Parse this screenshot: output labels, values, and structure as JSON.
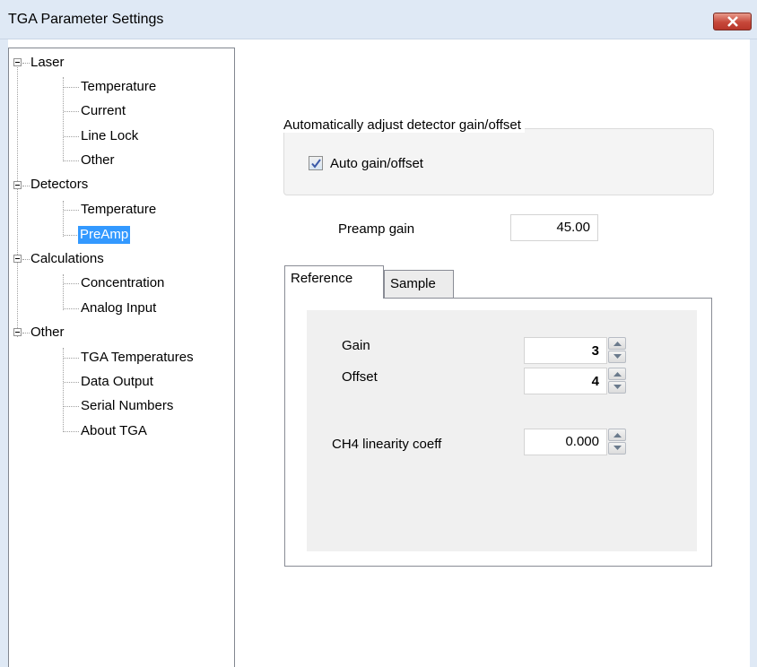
{
  "window": {
    "title": "TGA Parameter Settings"
  },
  "tree": [
    {
      "label": "Laser",
      "children": [
        "Temperature",
        "Current",
        "Line Lock",
        "Other"
      ]
    },
    {
      "label": "Detectors",
      "children": [
        "Temperature",
        "PreAmp"
      ]
    },
    {
      "label": "Calculations",
      "children": [
        "Concentration",
        "Analog Input"
      ]
    },
    {
      "label": "Other",
      "children": [
        "TGA Temperatures",
        "Data Output",
        "Serial Numbers",
        "About TGA"
      ]
    }
  ],
  "selected_item": "PreAmp",
  "auto_group": {
    "title": "Automatically adjust detector gain/offset",
    "checkbox_label": "Auto gain/offset",
    "checked": true
  },
  "preamp": {
    "label": "Preamp gain",
    "value": "45.00"
  },
  "tabs": [
    "Reference",
    "Sample"
  ],
  "active_tab": "Reference",
  "reference": {
    "gain_label": "Gain",
    "gain_value": "3",
    "offset_label": "Offset",
    "offset_value": "4",
    "ch4_label": "CH4 linearity coeff",
    "ch4_value": "0.000"
  }
}
